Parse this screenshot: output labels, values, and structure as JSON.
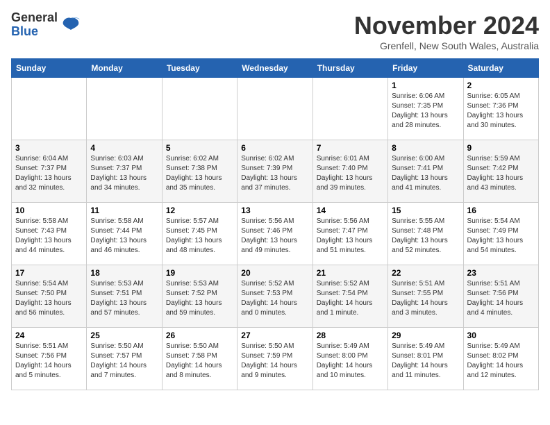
{
  "header": {
    "logo_general": "General",
    "logo_blue": "Blue",
    "month_title": "November 2024",
    "location": "Grenfell, New South Wales, Australia"
  },
  "weekdays": [
    "Sunday",
    "Monday",
    "Tuesday",
    "Wednesday",
    "Thursday",
    "Friday",
    "Saturday"
  ],
  "weeks": [
    [
      {
        "day": "",
        "detail": ""
      },
      {
        "day": "",
        "detail": ""
      },
      {
        "day": "",
        "detail": ""
      },
      {
        "day": "",
        "detail": ""
      },
      {
        "day": "",
        "detail": ""
      },
      {
        "day": "1",
        "detail": "Sunrise: 6:06 AM\nSunset: 7:35 PM\nDaylight: 13 hours\nand 28 minutes."
      },
      {
        "day": "2",
        "detail": "Sunrise: 6:05 AM\nSunset: 7:36 PM\nDaylight: 13 hours\nand 30 minutes."
      }
    ],
    [
      {
        "day": "3",
        "detail": "Sunrise: 6:04 AM\nSunset: 7:37 PM\nDaylight: 13 hours\nand 32 minutes."
      },
      {
        "day": "4",
        "detail": "Sunrise: 6:03 AM\nSunset: 7:37 PM\nDaylight: 13 hours\nand 34 minutes."
      },
      {
        "day": "5",
        "detail": "Sunrise: 6:02 AM\nSunset: 7:38 PM\nDaylight: 13 hours\nand 35 minutes."
      },
      {
        "day": "6",
        "detail": "Sunrise: 6:02 AM\nSunset: 7:39 PM\nDaylight: 13 hours\nand 37 minutes."
      },
      {
        "day": "7",
        "detail": "Sunrise: 6:01 AM\nSunset: 7:40 PM\nDaylight: 13 hours\nand 39 minutes."
      },
      {
        "day": "8",
        "detail": "Sunrise: 6:00 AM\nSunset: 7:41 PM\nDaylight: 13 hours\nand 41 minutes."
      },
      {
        "day": "9",
        "detail": "Sunrise: 5:59 AM\nSunset: 7:42 PM\nDaylight: 13 hours\nand 43 minutes."
      }
    ],
    [
      {
        "day": "10",
        "detail": "Sunrise: 5:58 AM\nSunset: 7:43 PM\nDaylight: 13 hours\nand 44 minutes."
      },
      {
        "day": "11",
        "detail": "Sunrise: 5:58 AM\nSunset: 7:44 PM\nDaylight: 13 hours\nand 46 minutes."
      },
      {
        "day": "12",
        "detail": "Sunrise: 5:57 AM\nSunset: 7:45 PM\nDaylight: 13 hours\nand 48 minutes."
      },
      {
        "day": "13",
        "detail": "Sunrise: 5:56 AM\nSunset: 7:46 PM\nDaylight: 13 hours\nand 49 minutes."
      },
      {
        "day": "14",
        "detail": "Sunrise: 5:56 AM\nSunset: 7:47 PM\nDaylight: 13 hours\nand 51 minutes."
      },
      {
        "day": "15",
        "detail": "Sunrise: 5:55 AM\nSunset: 7:48 PM\nDaylight: 13 hours\nand 52 minutes."
      },
      {
        "day": "16",
        "detail": "Sunrise: 5:54 AM\nSunset: 7:49 PM\nDaylight: 13 hours\nand 54 minutes."
      }
    ],
    [
      {
        "day": "17",
        "detail": "Sunrise: 5:54 AM\nSunset: 7:50 PM\nDaylight: 13 hours\nand 56 minutes."
      },
      {
        "day": "18",
        "detail": "Sunrise: 5:53 AM\nSunset: 7:51 PM\nDaylight: 13 hours\nand 57 minutes."
      },
      {
        "day": "19",
        "detail": "Sunrise: 5:53 AM\nSunset: 7:52 PM\nDaylight: 13 hours\nand 59 minutes."
      },
      {
        "day": "20",
        "detail": "Sunrise: 5:52 AM\nSunset: 7:53 PM\nDaylight: 14 hours\nand 0 minutes."
      },
      {
        "day": "21",
        "detail": "Sunrise: 5:52 AM\nSunset: 7:54 PM\nDaylight: 14 hours\nand 1 minute."
      },
      {
        "day": "22",
        "detail": "Sunrise: 5:51 AM\nSunset: 7:55 PM\nDaylight: 14 hours\nand 3 minutes."
      },
      {
        "day": "23",
        "detail": "Sunrise: 5:51 AM\nSunset: 7:56 PM\nDaylight: 14 hours\nand 4 minutes."
      }
    ],
    [
      {
        "day": "24",
        "detail": "Sunrise: 5:51 AM\nSunset: 7:56 PM\nDaylight: 14 hours\nand 5 minutes."
      },
      {
        "day": "25",
        "detail": "Sunrise: 5:50 AM\nSunset: 7:57 PM\nDaylight: 14 hours\nand 7 minutes."
      },
      {
        "day": "26",
        "detail": "Sunrise: 5:50 AM\nSunset: 7:58 PM\nDaylight: 14 hours\nand 8 minutes."
      },
      {
        "day": "27",
        "detail": "Sunrise: 5:50 AM\nSunset: 7:59 PM\nDaylight: 14 hours\nand 9 minutes."
      },
      {
        "day": "28",
        "detail": "Sunrise: 5:49 AM\nSunset: 8:00 PM\nDaylight: 14 hours\nand 10 minutes."
      },
      {
        "day": "29",
        "detail": "Sunrise: 5:49 AM\nSunset: 8:01 PM\nDaylight: 14 hours\nand 11 minutes."
      },
      {
        "day": "30",
        "detail": "Sunrise: 5:49 AM\nSunset: 8:02 PM\nDaylight: 14 hours\nand 12 minutes."
      }
    ]
  ]
}
